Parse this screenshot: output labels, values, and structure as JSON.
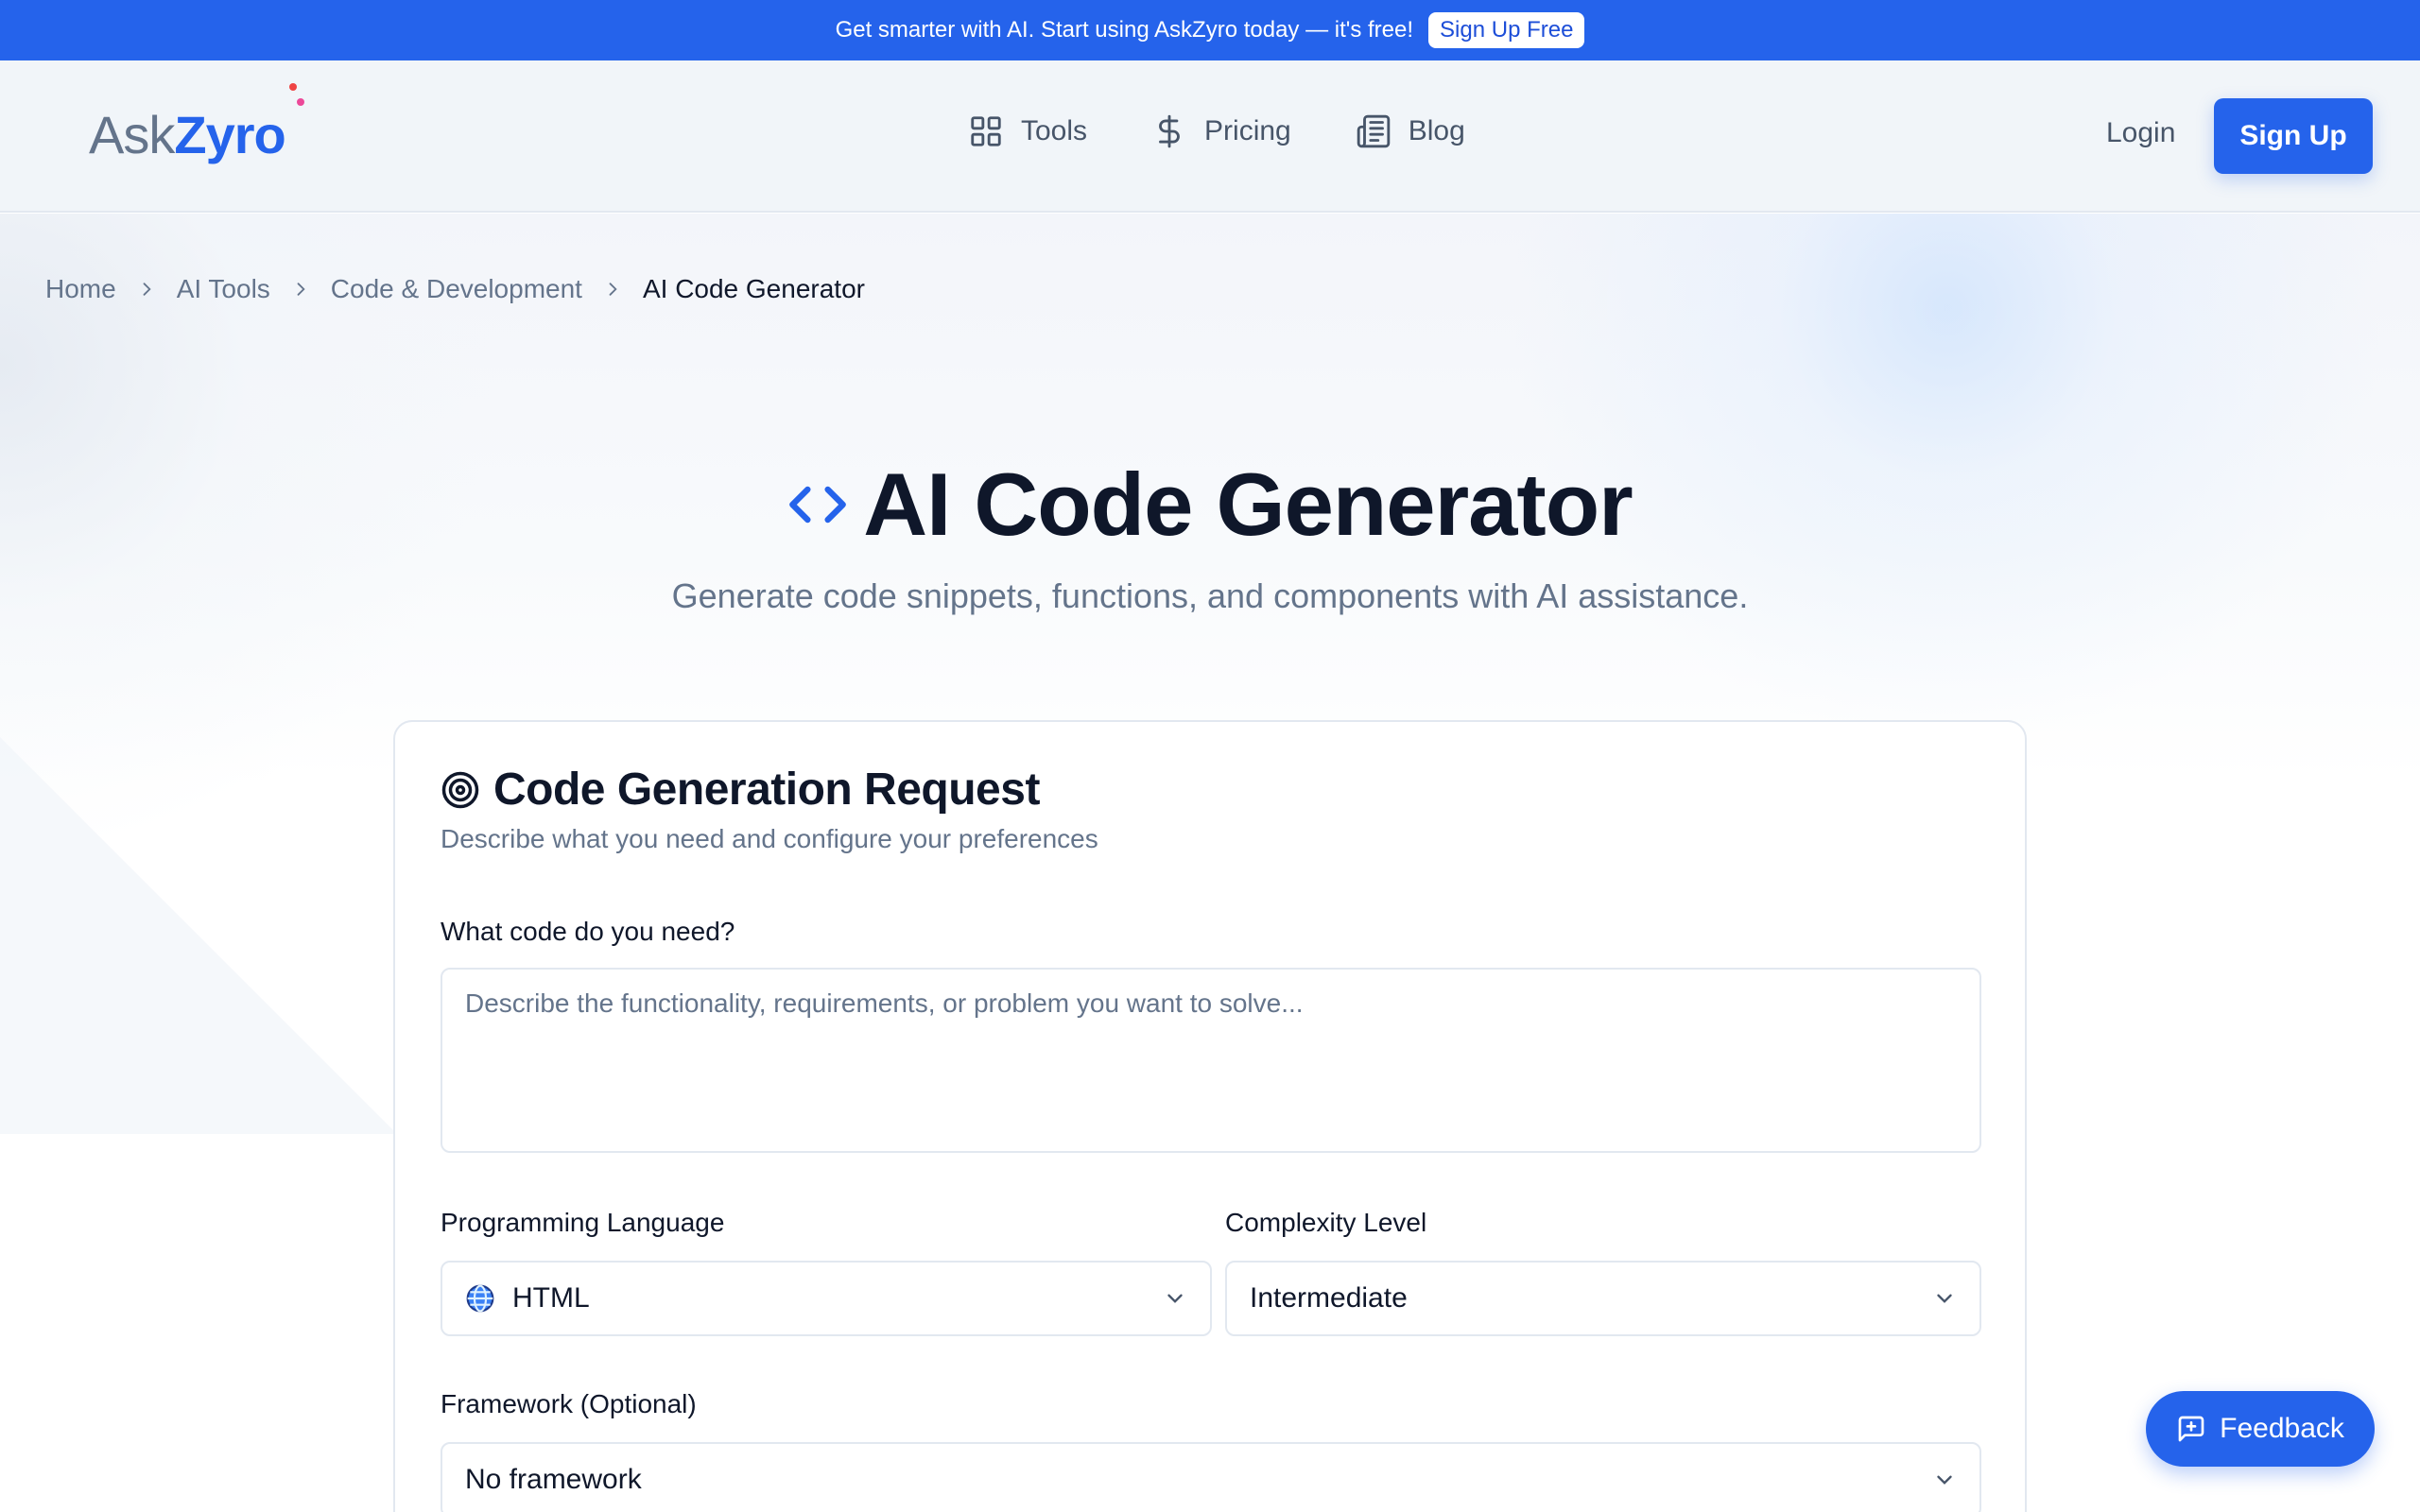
{
  "announcement": {
    "text": "Get smarter with AI. Start using AskZyro today — it's free!",
    "button_label": "Sign Up Free"
  },
  "header": {
    "logo_ask": "Ask",
    "logo_zyro": "Zyro",
    "nav": [
      {
        "label": "Tools",
        "icon": "grid-icon"
      },
      {
        "label": "Pricing",
        "icon": "dollar-icon"
      },
      {
        "label": "Blog",
        "icon": "newspaper-icon"
      }
    ],
    "login_label": "Login",
    "signup_label": "Sign Up"
  },
  "breadcrumb": [
    "Home",
    "AI Tools",
    "Code & Development",
    "AI Code Generator"
  ],
  "hero": {
    "title": "AI Code Generator",
    "subtitle": "Generate code snippets, functions, and components with AI assistance."
  },
  "card": {
    "title": "Code Generation Request",
    "subtitle": "Describe what you need and configure your preferences",
    "request_label": "What code do you need?",
    "request_placeholder": "Describe the functionality, requirements, or problem you want to solve...",
    "language_label": "Programming Language",
    "language_value": "HTML",
    "complexity_label": "Complexity Level",
    "complexity_value": "Intermediate",
    "framework_label": "Framework (Optional)",
    "framework_value": "No framework"
  },
  "feedback_label": "Feedback",
  "colors": {
    "brand": "#2563eb",
    "text": "#0f172a",
    "muted": "#64748b",
    "border": "#e2e8f0"
  }
}
